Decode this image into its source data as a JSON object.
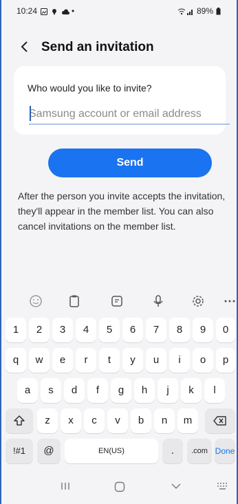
{
  "status_bar": {
    "time": "10:24",
    "battery": "89%"
  },
  "header": {
    "back_icon": "chevron-left-icon",
    "title": "Send an invitation"
  },
  "invite_card": {
    "question": "Who would you like to invite?",
    "input_placeholder": "Samsung account or email address"
  },
  "send_button": {
    "label": "Send"
  },
  "info_text": "After the person you invite accepts the invitation, they'll appear in the member list. You can also cancel invitations on the member list.",
  "keyboard": {
    "number_row": [
      "1",
      "2",
      "3",
      "4",
      "5",
      "6",
      "7",
      "8",
      "9",
      "0"
    ],
    "row1": [
      "q",
      "w",
      "e",
      "r",
      "t",
      "y",
      "u",
      "i",
      "o",
      "p"
    ],
    "row2": [
      "a",
      "s",
      "d",
      "f",
      "g",
      "h",
      "j",
      "k",
      "l"
    ],
    "row3": [
      "z",
      "x",
      "c",
      "v",
      "b",
      "n",
      "m"
    ],
    "symbols_label": "!#1",
    "at_label": "@",
    "space_label": "EN(US)",
    "dot_label": ".",
    "com_label": ".com",
    "done_label": "Done"
  },
  "colors": {
    "accent": "#1a73f0",
    "background": "#f4f4f6"
  }
}
